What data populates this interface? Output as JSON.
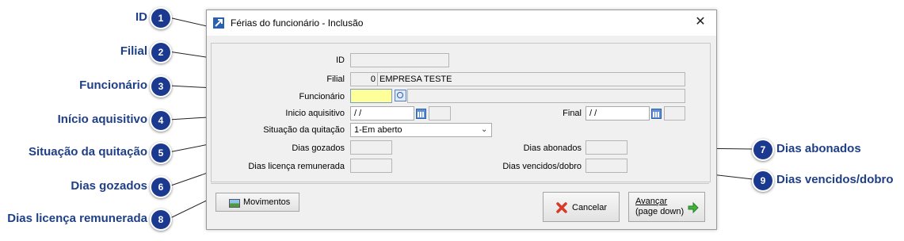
{
  "callouts": [
    {
      "number": "1",
      "label": "ID"
    },
    {
      "number": "2",
      "label": "Filial"
    },
    {
      "number": "3",
      "label": "Funcionário"
    },
    {
      "number": "4",
      "label": "Início aquisitivo"
    },
    {
      "number": "5",
      "label": "Situação da quitação"
    },
    {
      "number": "6",
      "label": "Dias gozados"
    },
    {
      "number": "7",
      "label": "Dias abonados"
    },
    {
      "number": "8",
      "label": "Dias licença remunerada"
    },
    {
      "number": "9",
      "label": "Dias vencidos/dobro"
    }
  ],
  "dialog": {
    "title": "Férias do funcionário - Inclusão",
    "close": "✕",
    "labels": {
      "id": "ID",
      "filial": "Filial",
      "funcionario": "Funcionário",
      "inicio": "Inicio aquisitivo",
      "final": "Final",
      "situacao": "Situação da quitação",
      "dias_gozados": "Dias gozados",
      "dias_licenca": "Dias licença remunerada",
      "dias_abonados": "Dias abonados",
      "dias_vencidos": "Dias vencidos/dobro"
    },
    "values": {
      "id": "",
      "filial_code": "0",
      "filial_name": "EMPRESA TESTE",
      "funcionario": "",
      "funcionario_name": "",
      "inicio": "/ /",
      "inicio_extra": "",
      "final": "/ /",
      "final_extra": "",
      "situacao": "1-Em aberto",
      "dias_gozados": "",
      "dias_licenca": "",
      "dias_abonados": "",
      "dias_vencidos": ""
    },
    "buttons": {
      "movimentos": "Movimentos",
      "cancelar": "Cancelar",
      "avancar_line1": "Avançar",
      "avancar_line2": "(page down)"
    }
  }
}
